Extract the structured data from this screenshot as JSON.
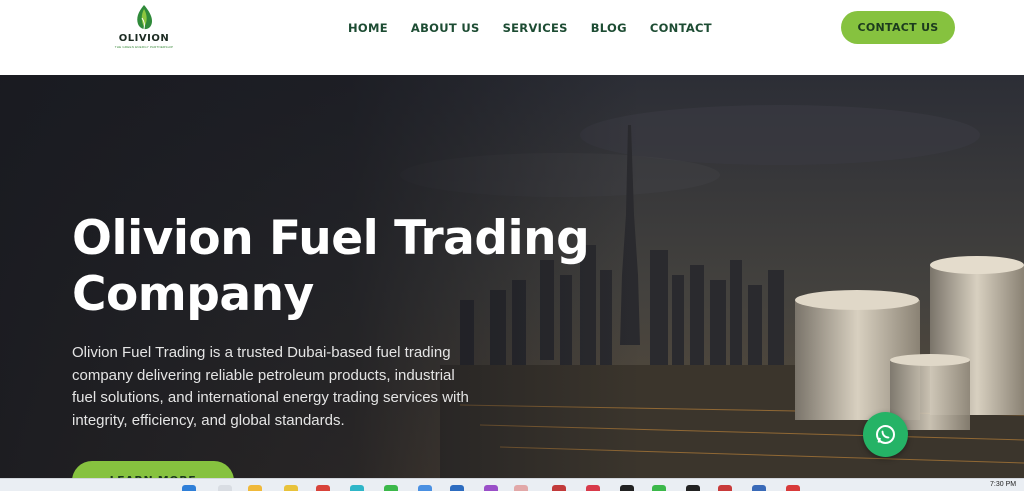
{
  "brand": {
    "name": "OLIVION",
    "tagline": "THE GREEN ENERGY PARTNERSHIP",
    "logo_icon": "leaf-drop-icon"
  },
  "nav": {
    "items": [
      "HOME",
      "ABOUT US",
      "SERVICES",
      "BLOG",
      "CONTACT"
    ]
  },
  "header_cta": {
    "label": "CONTACT US"
  },
  "hero": {
    "title": "Olivion Fuel Trading Company",
    "description": "Olivion Fuel Trading is a trusted Dubai-based fuel trading company delivering reliable petroleum products, industrial fuel solutions, and international energy trading services with integrity, efficiency, and global standards.",
    "button_label": "LEARN MORE"
  },
  "whatsapp": {
    "icon": "whatsapp-icon"
  },
  "taskbar": {
    "time": "7:30 PM"
  },
  "colors": {
    "accent": "#86c23f",
    "nav_text": "#1d4c33",
    "hero_bg": "#1d1f26",
    "whatsapp": "#25b366"
  }
}
